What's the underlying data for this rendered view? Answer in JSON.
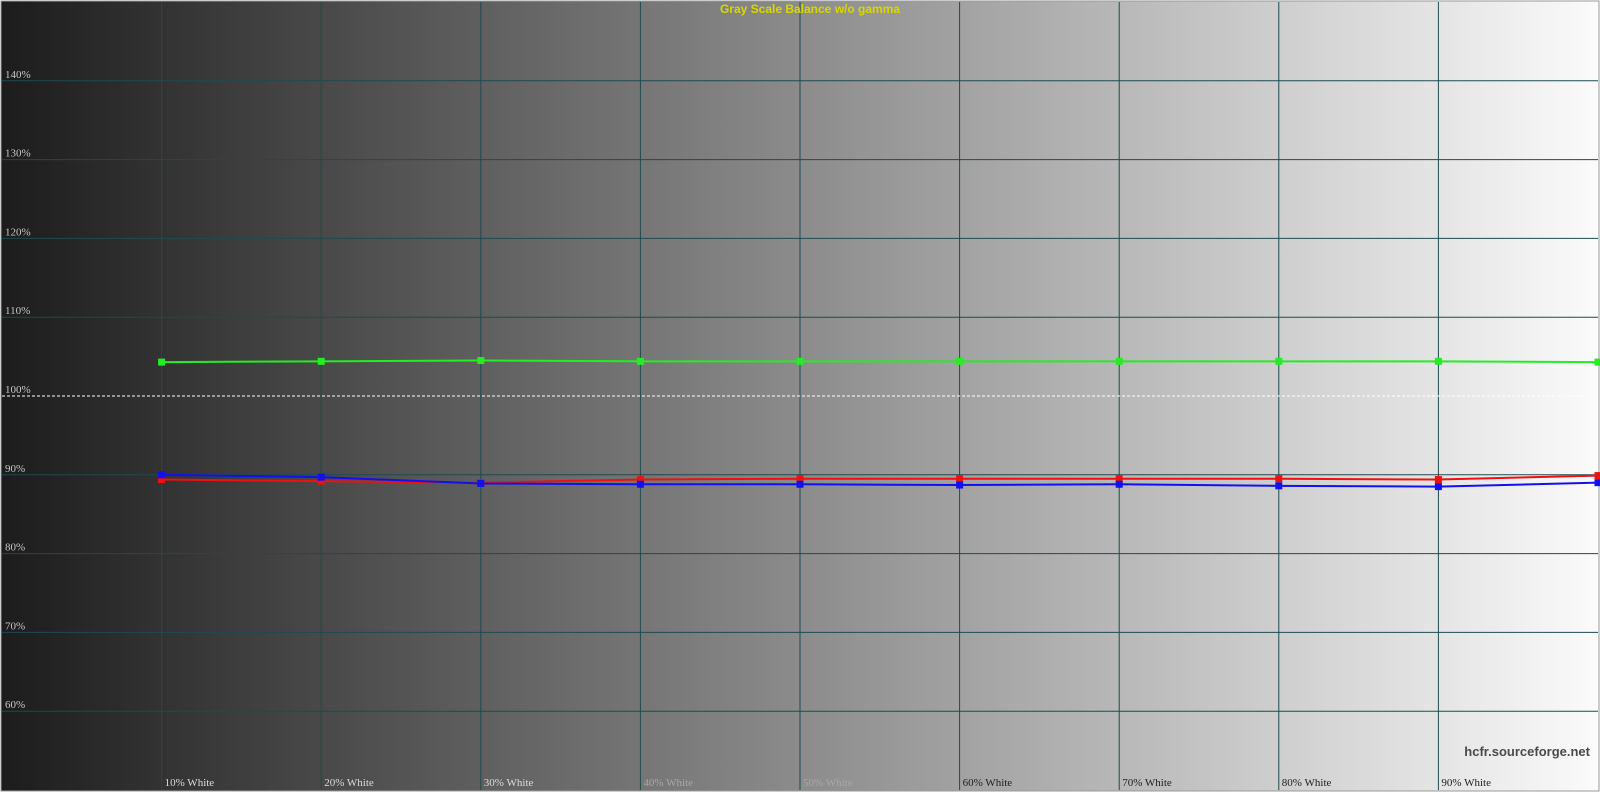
{
  "chart_data": {
    "type": "line",
    "title": "Gray Scale Balance w/o gamma",
    "xlabel": "",
    "ylabel": "",
    "x_categories": [
      "",
      "10% White",
      "20% White",
      "30% White",
      "40% White",
      "50% White",
      "60% White",
      "70% White",
      "80% White",
      "90% White",
      ""
    ],
    "ylim": [
      50,
      150
    ],
    "y_ticks": [
      140,
      130,
      120,
      110,
      100,
      90,
      80,
      70,
      60
    ],
    "y_tick_labels": [
      "140%",
      "130%",
      "120%",
      "110%",
      "100%",
      "90%",
      "80%",
      "70%",
      "60%"
    ],
    "reference_line": 100,
    "grid": true,
    "legend": "none",
    "series": [
      {
        "color": "#22ee22",
        "values": [
          null,
          104.3,
          104.4,
          104.5,
          104.4,
          104.4,
          104.4,
          104.4,
          104.4,
          104.4,
          104.3
        ]
      },
      {
        "color": "#ee1111",
        "values": [
          null,
          89.4,
          89.2,
          89.0,
          89.4,
          89.5,
          89.5,
          89.5,
          89.5,
          89.4,
          89.9
        ]
      },
      {
        "color": "#1111ee",
        "values": [
          null,
          90.0,
          89.7,
          88.9,
          88.8,
          88.8,
          88.7,
          88.8,
          88.6,
          88.5,
          89.0
        ]
      }
    ]
  },
  "watermark": "hcfr.sourceforge.net"
}
